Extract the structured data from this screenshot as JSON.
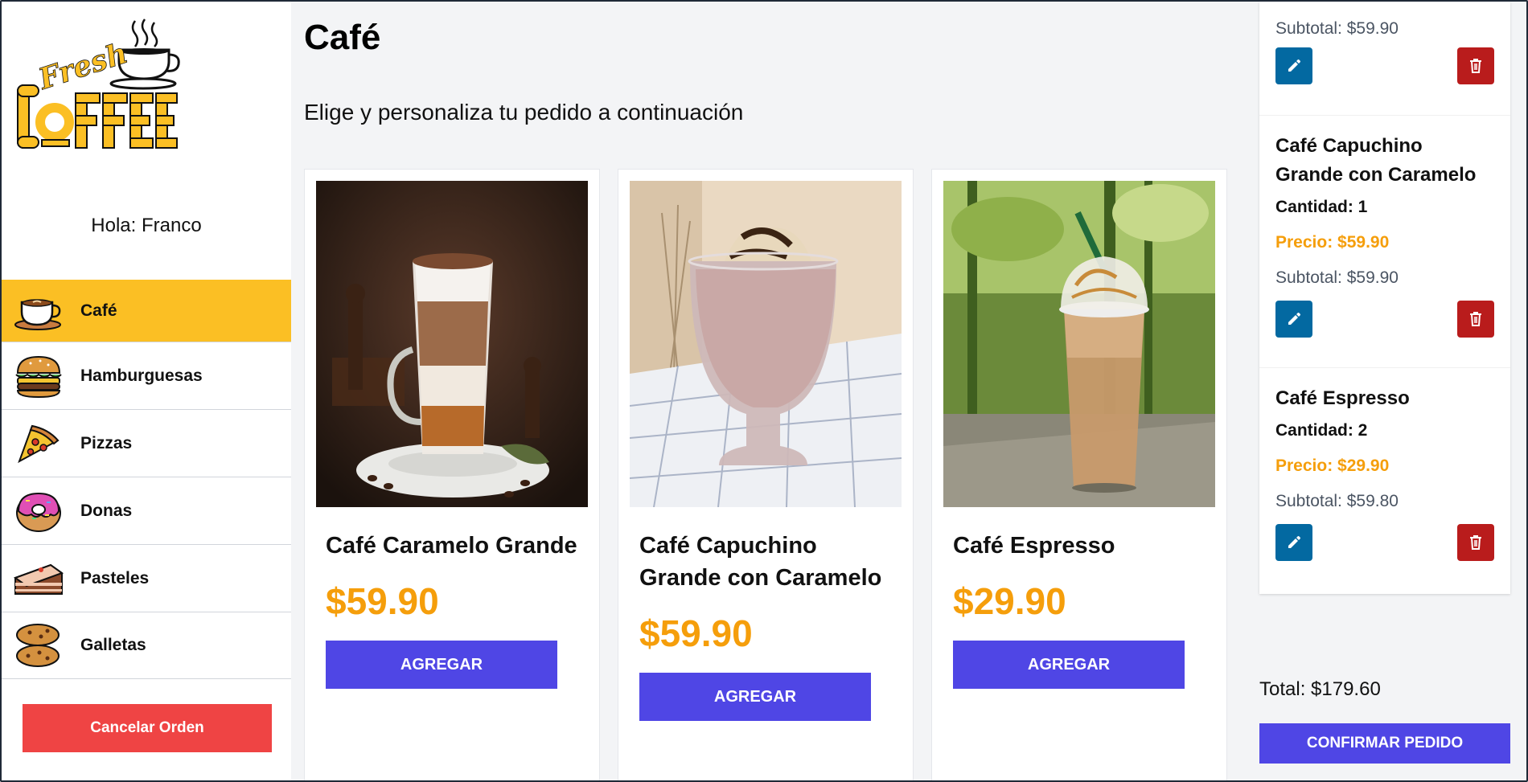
{
  "brand": {
    "logo_word_top": "Fresh",
    "logo_word_main": "COFFEE",
    "logo_icon": "coffee-cup-icon"
  },
  "greeting": "Hola: Franco",
  "categories": [
    {
      "label": "Café",
      "icon": "coffee-icon",
      "active": true
    },
    {
      "label": "Hamburguesas",
      "icon": "burger-icon",
      "active": false
    },
    {
      "label": "Pizzas",
      "icon": "pizza-icon",
      "active": false
    },
    {
      "label": "Donas",
      "icon": "donut-icon",
      "active": false
    },
    {
      "label": "Pasteles",
      "icon": "cake-icon",
      "active": false
    },
    {
      "label": "Galletas",
      "icon": "cookie-icon",
      "active": false
    }
  ],
  "cancel_label": "Cancelar Orden",
  "main": {
    "title": "Café",
    "subtitle": "Elige y personaliza tu pedido a continuación",
    "products": [
      {
        "name": "Café Caramelo Grande",
        "price": "$59.90",
        "button": "AGREGAR"
      },
      {
        "name": "Café Capuchino Grande con Caramelo",
        "price": "$59.90",
        "button": "AGREGAR"
      },
      {
        "name": "Café Espresso",
        "price": "$29.90",
        "button": "AGREGAR"
      }
    ]
  },
  "summary": {
    "items": [
      {
        "name": "",
        "qty": "",
        "price": "",
        "subtotal": "Subtotal: $59.90"
      },
      {
        "name": "Café Capuchino Grande con Caramelo",
        "qty": "Cantidad: 1",
        "price": "Precio: $59.90",
        "subtotal": "Subtotal: $59.90"
      },
      {
        "name": "Café Espresso",
        "qty": "Cantidad: 2",
        "price": "Precio: $29.90",
        "subtotal": "Subtotal: $59.80"
      }
    ],
    "total": "Total: $179.60",
    "confirm_label": "CONFIRMAR PEDIDO"
  },
  "colors": {
    "accent": "#fbbf24",
    "primary": "#4f46e5",
    "danger": "#ef4444",
    "price": "#f59e0b",
    "edit": "#0369a1",
    "delete": "#b91c1c"
  }
}
